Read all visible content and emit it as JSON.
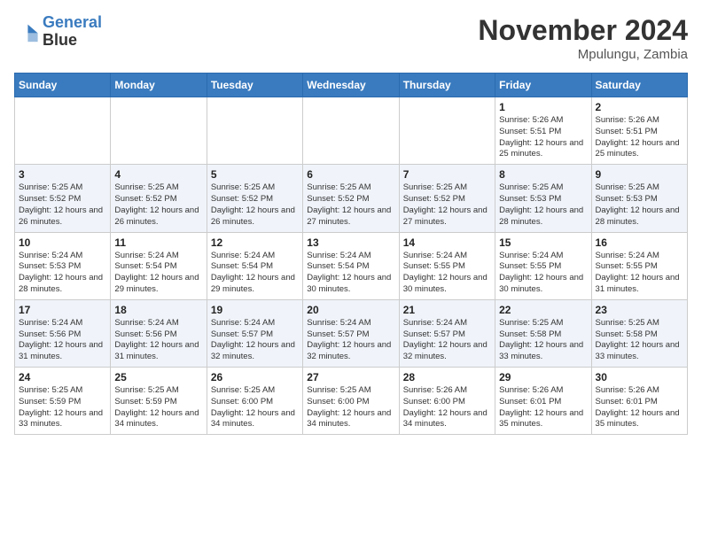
{
  "header": {
    "logo_line1": "General",
    "logo_line2": "Blue",
    "month": "November 2024",
    "location": "Mpulungu, Zambia"
  },
  "weekdays": [
    "Sunday",
    "Monday",
    "Tuesday",
    "Wednesday",
    "Thursday",
    "Friday",
    "Saturday"
  ],
  "weeks": [
    [
      {
        "day": "",
        "info": ""
      },
      {
        "day": "",
        "info": ""
      },
      {
        "day": "",
        "info": ""
      },
      {
        "day": "",
        "info": ""
      },
      {
        "day": "",
        "info": ""
      },
      {
        "day": "1",
        "info": "Sunrise: 5:26 AM\nSunset: 5:51 PM\nDaylight: 12 hours and 25 minutes."
      },
      {
        "day": "2",
        "info": "Sunrise: 5:26 AM\nSunset: 5:51 PM\nDaylight: 12 hours and 25 minutes."
      }
    ],
    [
      {
        "day": "3",
        "info": "Sunrise: 5:25 AM\nSunset: 5:52 PM\nDaylight: 12 hours and 26 minutes."
      },
      {
        "day": "4",
        "info": "Sunrise: 5:25 AM\nSunset: 5:52 PM\nDaylight: 12 hours and 26 minutes."
      },
      {
        "day": "5",
        "info": "Sunrise: 5:25 AM\nSunset: 5:52 PM\nDaylight: 12 hours and 26 minutes."
      },
      {
        "day": "6",
        "info": "Sunrise: 5:25 AM\nSunset: 5:52 PM\nDaylight: 12 hours and 27 minutes."
      },
      {
        "day": "7",
        "info": "Sunrise: 5:25 AM\nSunset: 5:52 PM\nDaylight: 12 hours and 27 minutes."
      },
      {
        "day": "8",
        "info": "Sunrise: 5:25 AM\nSunset: 5:53 PM\nDaylight: 12 hours and 28 minutes."
      },
      {
        "day": "9",
        "info": "Sunrise: 5:25 AM\nSunset: 5:53 PM\nDaylight: 12 hours and 28 minutes."
      }
    ],
    [
      {
        "day": "10",
        "info": "Sunrise: 5:24 AM\nSunset: 5:53 PM\nDaylight: 12 hours and 28 minutes."
      },
      {
        "day": "11",
        "info": "Sunrise: 5:24 AM\nSunset: 5:54 PM\nDaylight: 12 hours and 29 minutes."
      },
      {
        "day": "12",
        "info": "Sunrise: 5:24 AM\nSunset: 5:54 PM\nDaylight: 12 hours and 29 minutes."
      },
      {
        "day": "13",
        "info": "Sunrise: 5:24 AM\nSunset: 5:54 PM\nDaylight: 12 hours and 30 minutes."
      },
      {
        "day": "14",
        "info": "Sunrise: 5:24 AM\nSunset: 5:55 PM\nDaylight: 12 hours and 30 minutes."
      },
      {
        "day": "15",
        "info": "Sunrise: 5:24 AM\nSunset: 5:55 PM\nDaylight: 12 hours and 30 minutes."
      },
      {
        "day": "16",
        "info": "Sunrise: 5:24 AM\nSunset: 5:55 PM\nDaylight: 12 hours and 31 minutes."
      }
    ],
    [
      {
        "day": "17",
        "info": "Sunrise: 5:24 AM\nSunset: 5:56 PM\nDaylight: 12 hours and 31 minutes."
      },
      {
        "day": "18",
        "info": "Sunrise: 5:24 AM\nSunset: 5:56 PM\nDaylight: 12 hours and 31 minutes."
      },
      {
        "day": "19",
        "info": "Sunrise: 5:24 AM\nSunset: 5:57 PM\nDaylight: 12 hours and 32 minutes."
      },
      {
        "day": "20",
        "info": "Sunrise: 5:24 AM\nSunset: 5:57 PM\nDaylight: 12 hours and 32 minutes."
      },
      {
        "day": "21",
        "info": "Sunrise: 5:24 AM\nSunset: 5:57 PM\nDaylight: 12 hours and 32 minutes."
      },
      {
        "day": "22",
        "info": "Sunrise: 5:25 AM\nSunset: 5:58 PM\nDaylight: 12 hours and 33 minutes."
      },
      {
        "day": "23",
        "info": "Sunrise: 5:25 AM\nSunset: 5:58 PM\nDaylight: 12 hours and 33 minutes."
      }
    ],
    [
      {
        "day": "24",
        "info": "Sunrise: 5:25 AM\nSunset: 5:59 PM\nDaylight: 12 hours and 33 minutes."
      },
      {
        "day": "25",
        "info": "Sunrise: 5:25 AM\nSunset: 5:59 PM\nDaylight: 12 hours and 34 minutes."
      },
      {
        "day": "26",
        "info": "Sunrise: 5:25 AM\nSunset: 6:00 PM\nDaylight: 12 hours and 34 minutes."
      },
      {
        "day": "27",
        "info": "Sunrise: 5:25 AM\nSunset: 6:00 PM\nDaylight: 12 hours and 34 minutes."
      },
      {
        "day": "28",
        "info": "Sunrise: 5:26 AM\nSunset: 6:00 PM\nDaylight: 12 hours and 34 minutes."
      },
      {
        "day": "29",
        "info": "Sunrise: 5:26 AM\nSunset: 6:01 PM\nDaylight: 12 hours and 35 minutes."
      },
      {
        "day": "30",
        "info": "Sunrise: 5:26 AM\nSunset: 6:01 PM\nDaylight: 12 hours and 35 minutes."
      }
    ]
  ]
}
